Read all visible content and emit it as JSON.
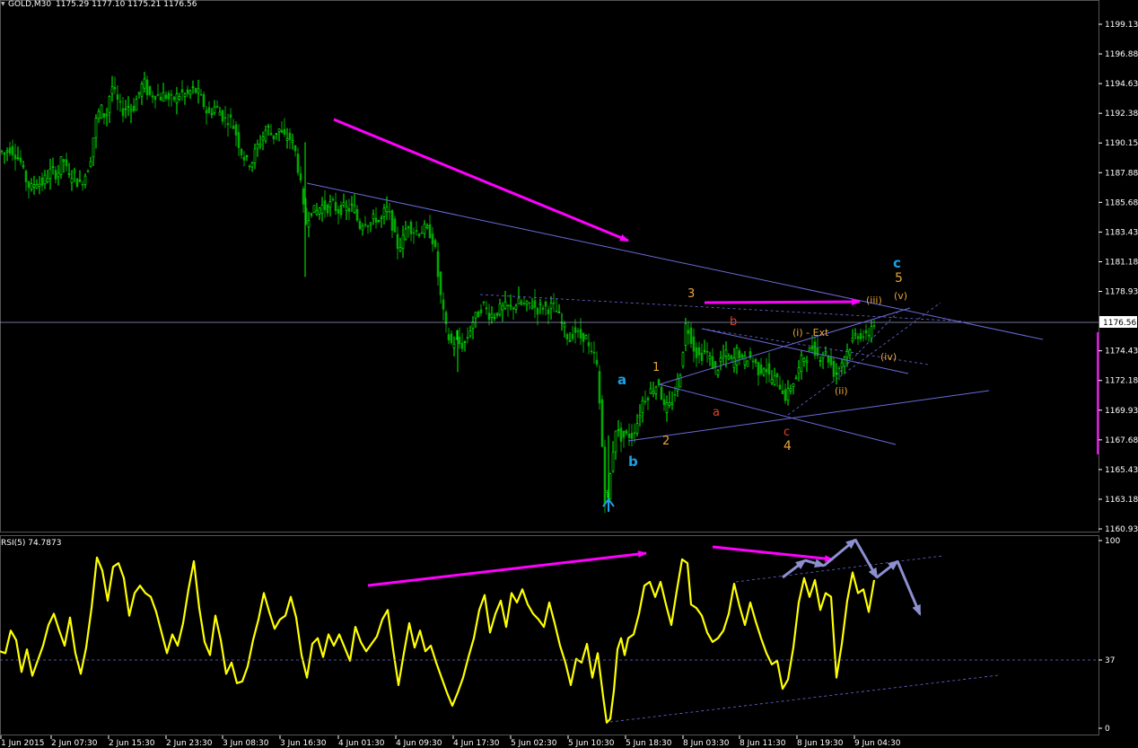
{
  "header": {
    "symbol_timeframe": "GOLD,M30",
    "ohlc": "1175.29 1177.10 1175.21 1176.56",
    "dropdown_glyph": "▼"
  },
  "colors": {
    "background": "#000000",
    "bull_candle": "#00ff00",
    "bear_candle": "#00aa00",
    "trend_line": "#6a6ad8",
    "magenta_arrow": "#ff00ff",
    "rsi_line": "#ffff00",
    "wave_orange": "#e8a43c",
    "wave_red": "#e0402c",
    "wave_blue": "#1ea0e6",
    "grey_arrow": "#8d8fd0"
  },
  "chart_data": [
    {
      "type": "candlestick",
      "name": "main-price",
      "symbol": "GOLD,M30",
      "ohlc_last": {
        "open": 1175.29,
        "high": 1177.1,
        "low": 1175.21,
        "close": 1176.56
      },
      "current_price": 1176.56,
      "y_ticks": [
        "1199.13",
        "1196.88",
        "1194.63",
        "1192.38",
        "1190.15",
        "1187.88",
        "1185.68",
        "1183.43",
        "1181.18",
        "1178.93",
        "1174.43",
        "1172.18",
        "1169.93",
        "1167.68",
        "1165.43",
        "1163.18",
        "1160.93"
      ],
      "x_ticks": [
        "1 Jun 2015",
        "2 Jun 07:30",
        "2 Jun 15:30",
        "2 Jun 23:30",
        "3 Jun 08:30",
        "3 Jun 16:30",
        "4 Jun 01:30",
        "4 Jun 09:30",
        "4 Jun 17:30",
        "5 Jun 02:30",
        "5 Jun 10:30",
        "5 Jun 18:30",
        "8 Jun 03:30",
        "8 Jun 11:30",
        "8 Jun 19:30",
        "9 Jun 04:30"
      ],
      "ylim": [
        1160.0,
        1201.0
      ],
      "price_path": [
        [
          0,
          1189.6
        ],
        [
          6,
          1189.3
        ],
        [
          12,
          1189.8
        ],
        [
          18,
          1189.4
        ],
        [
          24,
          1188.9
        ],
        [
          30,
          1187.5
        ],
        [
          36,
          1186.6
        ],
        [
          42,
          1187.3
        ],
        [
          48,
          1187.0
        ],
        [
          54,
          1187.6
        ],
        [
          60,
          1188.1
        ],
        [
          66,
          1187.7
        ],
        [
          72,
          1189.2
        ],
        [
          78,
          1187.5
        ],
        [
          84,
          1187.9
        ],
        [
          90,
          1186.9
        ],
        [
          96,
          1187.6
        ],
        [
          102,
          1188.6
        ],
        [
          108,
          1191.6
        ],
        [
          114,
          1192.8
        ],
        [
          120,
          1192.0
        ],
        [
          126,
          1194.6
        ],
        [
          132,
          1193.4
        ],
        [
          138,
          1192.5
        ],
        [
          144,
          1193.0
        ],
        [
          150,
          1192.7
        ],
        [
          156,
          1193.8
        ],
        [
          162,
          1194.8
        ],
        [
          168,
          1193.7
        ],
        [
          174,
          1193.9
        ],
        [
          180,
          1193.6
        ],
        [
          186,
          1193.8
        ],
        [
          192,
          1193.3
        ],
        [
          198,
          1193.6
        ],
        [
          204,
          1193.9
        ],
        [
          210,
          1193.7
        ],
        [
          216,
          1194.2
        ],
        [
          222,
          1194.0
        ],
        [
          228,
          1193.2
        ],
        [
          234,
          1192.2
        ],
        [
          240,
          1192.9
        ],
        [
          246,
          1192.6
        ],
        [
          252,
          1191.9
        ],
        [
          258,
          1192.0
        ],
        [
          264,
          1191.1
        ],
        [
          270,
          1189.6
        ],
        [
          276,
          1188.8
        ],
        [
          282,
          1188.6
        ],
        [
          288,
          1189.8
        ],
        [
          294,
          1190.5
        ],
        [
          300,
          1191.4
        ],
        [
          306,
          1190.5
        ],
        [
          312,
          1191.3
        ],
        [
          318,
          1190.5
        ],
        [
          324,
          1190.6
        ],
        [
          330,
          1189.8
        ],
        [
          336,
          1187.5
        ],
        [
          342,
          1183.9
        ],
        [
          348,
          1185.1
        ],
        [
          354,
          1184.9
        ],
        [
          360,
          1185.4
        ],
        [
          366,
          1185.2
        ],
        [
          372,
          1185.6
        ],
        [
          378,
          1185.0
        ],
        [
          384,
          1185.2
        ],
        [
          390,
          1185.1
        ],
        [
          396,
          1185.4
        ],
        [
          402,
          1183.8
        ],
        [
          408,
          1184.3
        ],
        [
          414,
          1184.0
        ],
        [
          420,
          1184.5
        ],
        [
          426,
          1184.2
        ],
        [
          432,
          1185.2
        ],
        [
          438,
          1184.3
        ],
        [
          444,
          1182.3
        ],
        [
          450,
          1182.6
        ],
        [
          456,
          1184.1
        ],
        [
          462,
          1183.5
        ],
        [
          468,
          1183.4
        ],
        [
          474,
          1183.6
        ],
        [
          480,
          1183.5
        ],
        [
          486,
          1182.5
        ],
        [
          492,
          1178.9
        ],
        [
          498,
          1176.3
        ],
        [
          504,
          1174.9
        ],
        [
          510,
          1175.2
        ],
        [
          516,
          1174.8
        ],
        [
          522,
          1175.2
        ],
        [
          528,
          1176.6
        ],
        [
          534,
          1177.1
        ],
        [
          540,
          1178.0
        ],
        [
          546,
          1177.2
        ],
        [
          552,
          1177.1
        ],
        [
          558,
          1177.5
        ],
        [
          564,
          1177.7
        ],
        [
          570,
          1177.6
        ],
        [
          576,
          1177.9
        ],
        [
          582,
          1178.1
        ],
        [
          588,
          1177.7
        ],
        [
          594,
          1178.1
        ],
        [
          600,
          1177.5
        ],
        [
          606,
          1177.8
        ],
        [
          612,
          1177.6
        ],
        [
          618,
          1177.8
        ],
        [
          624,
          1177.1
        ],
        [
          630,
          1176.2
        ],
        [
          636,
          1175.2
        ],
        [
          642,
          1176.0
        ],
        [
          648,
          1175.4
        ],
        [
          654,
          1175.6
        ],
        [
          660,
          1174.0
        ],
        [
          666,
          1174.1
        ],
        [
          672,
          1168.5
        ],
        [
          676,
          1163.3
        ],
        [
          680,
          1163.6
        ],
        [
          684,
          1166.4
        ],
        [
          688,
          1168.6
        ],
        [
          692,
          1168.0
        ],
        [
          696,
          1167.8
        ],
        [
          700,
          1168.1
        ],
        [
          706,
          1168.0
        ],
        [
          712,
          1169.0
        ],
        [
          718,
          1170.6
        ],
        [
          724,
          1171.1
        ],
        [
          730,
          1171.6
        ],
        [
          736,
          1172.0
        ],
        [
          742,
          1170.0
        ],
        [
          748,
          1170.2
        ],
        [
          754,
          1171.2
        ],
        [
          760,
          1172.9
        ],
        [
          766,
          1176.3
        ],
        [
          770,
          1175.9
        ],
        [
          776,
          1174.4
        ],
        [
          782,
          1173.9
        ],
        [
          788,
          1174.5
        ],
        [
          794,
          1173.6
        ],
        [
          800,
          1172.8
        ],
        [
          806,
          1173.9
        ],
        [
          812,
          1174.1
        ],
        [
          818,
          1173.4
        ],
        [
          824,
          1174.5
        ],
        [
          830,
          1173.5
        ],
        [
          836,
          1174.0
        ],
        [
          842,
          1173.6
        ],
        [
          848,
          1172.8
        ],
        [
          854,
          1173.4
        ],
        [
          860,
          1172.2
        ],
        [
          866,
          1172.3
        ],
        [
          872,
          1171.7
        ],
        [
          878,
          1170.8
        ],
        [
          884,
          1171.9
        ],
        [
          890,
          1172.5
        ],
        [
          896,
          1173.9
        ],
        [
          902,
          1174.1
        ],
        [
          908,
          1174.8
        ],
        [
          914,
          1173.9
        ],
        [
          920,
          1174.4
        ],
        [
          926,
          1173.7
        ],
        [
          932,
          1172.6
        ],
        [
          938,
          1173.3
        ],
        [
          944,
          1174.2
        ],
        [
          950,
          1174.9
        ],
        [
          956,
          1175.7
        ],
        [
          962,
          1175.6
        ],
        [
          968,
          1175.3
        ],
        [
          974,
          1176.5
        ]
      ]
    },
    {
      "type": "line",
      "name": "RSI(5)",
      "indicator_label": "RSI(5) 74.7873",
      "last_value": 74.7873,
      "y_ticks": [
        "100",
        "37",
        "0"
      ],
      "ylim": [
        0,
        100
      ],
      "values": [
        [
          0,
          41
        ],
        [
          6,
          40
        ],
        [
          12,
          52
        ],
        [
          18,
          47
        ],
        [
          24,
          30
        ],
        [
          30,
          42
        ],
        [
          36,
          28
        ],
        [
          42,
          36
        ],
        [
          48,
          44
        ],
        [
          54,
          55
        ],
        [
          60,
          61
        ],
        [
          66,
          52
        ],
        [
          72,
          44
        ],
        [
          78,
          59
        ],
        [
          84,
          40
        ],
        [
          90,
          29
        ],
        [
          96,
          43
        ],
        [
          102,
          64
        ],
        [
          108,
          91
        ],
        [
          114,
          84
        ],
        [
          120,
          68
        ],
        [
          126,
          86
        ],
        [
          132,
          88
        ],
        [
          138,
          80
        ],
        [
          144,
          60
        ],
        [
          150,
          72
        ],
        [
          156,
          76
        ],
        [
          162,
          72
        ],
        [
          168,
          70
        ],
        [
          174,
          62
        ],
        [
          180,
          51
        ],
        [
          186,
          40
        ],
        [
          192,
          50
        ],
        [
          198,
          44
        ],
        [
          204,
          56
        ],
        [
          210,
          74
        ],
        [
          216,
          89
        ],
        [
          222,
          64
        ],
        [
          228,
          46
        ],
        [
          234,
          39
        ],
        [
          240,
          60
        ],
        [
          246,
          47
        ],
        [
          252,
          29
        ],
        [
          258,
          35
        ],
        [
          264,
          24
        ],
        [
          270,
          25
        ],
        [
          276,
          33
        ],
        [
          282,
          47
        ],
        [
          288,
          58
        ],
        [
          294,
          72
        ],
        [
          300,
          62
        ],
        [
          306,
          53
        ],
        [
          312,
          58
        ],
        [
          318,
          60
        ],
        [
          324,
          70
        ],
        [
          330,
          59
        ],
        [
          336,
          39
        ],
        [
          342,
          27
        ],
        [
          348,
          45
        ],
        [
          354,
          48
        ],
        [
          360,
          38
        ],
        [
          366,
          50
        ],
        [
          372,
          44
        ],
        [
          378,
          50
        ],
        [
          384,
          43
        ],
        [
          390,
          36
        ],
        [
          396,
          54
        ],
        [
          402,
          46
        ],
        [
          408,
          41
        ],
        [
          414,
          45
        ],
        [
          420,
          49
        ],
        [
          426,
          58
        ],
        [
          432,
          63
        ],
        [
          438,
          42
        ],
        [
          444,
          23
        ],
        [
          450,
          40
        ],
        [
          456,
          56
        ],
        [
          462,
          43
        ],
        [
          468,
          52
        ],
        [
          474,
          41
        ],
        [
          480,
          44
        ],
        [
          486,
          35
        ],
        [
          492,
          27
        ],
        [
          498,
          19
        ],
        [
          504,
          12
        ],
        [
          510,
          19
        ],
        [
          516,
          27
        ],
        [
          522,
          38
        ],
        [
          528,
          48
        ],
        [
          534,
          63
        ],
        [
          540,
          71
        ],
        [
          546,
          51
        ],
        [
          552,
          61
        ],
        [
          558,
          68
        ],
        [
          564,
          54
        ],
        [
          570,
          72
        ],
        [
          576,
          67
        ],
        [
          582,
          74
        ],
        [
          588,
          66
        ],
        [
          594,
          61
        ],
        [
          600,
          58
        ],
        [
          606,
          54
        ],
        [
          612,
          67
        ],
        [
          618,
          56
        ],
        [
          624,
          44
        ],
        [
          630,
          35
        ],
        [
          636,
          23
        ],
        [
          642,
          37
        ],
        [
          648,
          35
        ],
        [
          654,
          45
        ],
        [
          660,
          27
        ],
        [
          666,
          40
        ],
        [
          672,
          17
        ],
        [
          676,
          3
        ],
        [
          680,
          5
        ],
        [
          684,
          20
        ],
        [
          688,
          42
        ],
        [
          692,
          48
        ],
        [
          696,
          39
        ],
        [
          700,
          48
        ],
        [
          706,
          50
        ],
        [
          712,
          61
        ],
        [
          718,
          76
        ],
        [
          724,
          78
        ],
        [
          730,
          70
        ],
        [
          736,
          78
        ],
        [
          742,
          66
        ],
        [
          748,
          55
        ],
        [
          754,
          73
        ],
        [
          760,
          90
        ],
        [
          766,
          88
        ],
        [
          770,
          66
        ],
        [
          776,
          64
        ],
        [
          782,
          60
        ],
        [
          788,
          51
        ],
        [
          794,
          46
        ],
        [
          800,
          48
        ],
        [
          806,
          52
        ],
        [
          812,
          61
        ],
        [
          818,
          77
        ],
        [
          824,
          65
        ],
        [
          830,
          55
        ],
        [
          836,
          67
        ],
        [
          842,
          57
        ],
        [
          848,
          48
        ],
        [
          854,
          40
        ],
        [
          860,
          34
        ],
        [
          866,
          36
        ],
        [
          872,
          21
        ],
        [
          878,
          26
        ],
        [
          884,
          43
        ],
        [
          890,
          67
        ],
        [
          896,
          80
        ],
        [
          902,
          70
        ],
        [
          908,
          79
        ],
        [
          914,
          63
        ],
        [
          920,
          72
        ],
        [
          926,
          70
        ],
        [
          932,
          27
        ],
        [
          938,
          45
        ],
        [
          944,
          68
        ],
        [
          950,
          83
        ],
        [
          956,
          72
        ],
        [
          962,
          74
        ],
        [
          968,
          62
        ],
        [
          974,
          79
        ]
      ]
    }
  ],
  "annotations": {
    "wave_a_blue": "a",
    "wave_b_blue": "b",
    "wave_c_blue": "c",
    "wave_1": "1",
    "wave_2": "2",
    "wave_3": "3",
    "wave_4": "4",
    "wave_5": "5",
    "wave_a_red": "a",
    "wave_b_red": "b",
    "wave_c_red": "c",
    "sub_i_ext": "(i) - Ext",
    "sub_ii": "(ii)",
    "sub_iii": "(iii)",
    "sub_iv": "(iv)",
    "sub_v": "(v)"
  }
}
